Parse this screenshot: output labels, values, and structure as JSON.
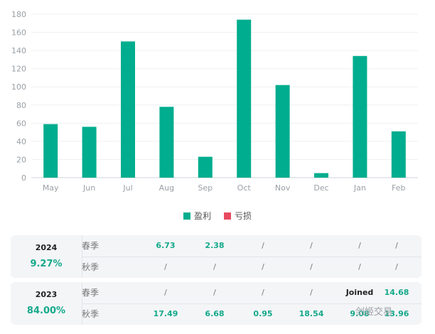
{
  "chart_data": {
    "type": "bar",
    "categories": [
      "May",
      "Jun",
      "Jul",
      "Aug",
      "Sep",
      "Oct",
      "Nov",
      "Dec",
      "Jan",
      "Feb"
    ],
    "series": [
      {
        "name": "盈利",
        "color": "#00ad8e",
        "values": [
          59,
          56,
          150,
          78,
          23,
          174,
          102,
          5,
          134,
          51
        ]
      },
      {
        "name": "亏损",
        "color": "#e84a5f",
        "values": [
          0,
          0,
          0,
          0,
          0,
          0,
          0,
          0,
          0,
          0
        ]
      }
    ],
    "ylim": [
      0,
      180
    ],
    "yticks": [
      0,
      20,
      40,
      60,
      80,
      100,
      120,
      140,
      160,
      180
    ],
    "grid": true,
    "legend_position": "bottom"
  },
  "legend": [
    {
      "label": "盈利",
      "color": "#00ad8e"
    },
    {
      "label": "亏损",
      "color": "#e84a5f"
    }
  ],
  "years": [
    {
      "year": "2024",
      "total": "9.27%",
      "rows": [
        {
          "season": "春季",
          "cells": [
            "6.73",
            "2.38",
            "/",
            "/",
            "/",
            "/"
          ]
        },
        {
          "season": "秋季",
          "cells": [
            "/",
            "/",
            "/",
            "/",
            "/",
            "/"
          ]
        }
      ]
    },
    {
      "year": "2023",
      "total": "84.00%",
      "rows": [
        {
          "season": "春季",
          "cells": [
            "/",
            "/",
            "/",
            "/",
            "Joined",
            "14.68"
          ]
        },
        {
          "season": "秋季",
          "cells": [
            "17.49",
            "6.68",
            "0.95",
            "18.54",
            "9.08",
            "13.96"
          ]
        }
      ]
    }
  ],
  "watermark": "剑姬交易"
}
